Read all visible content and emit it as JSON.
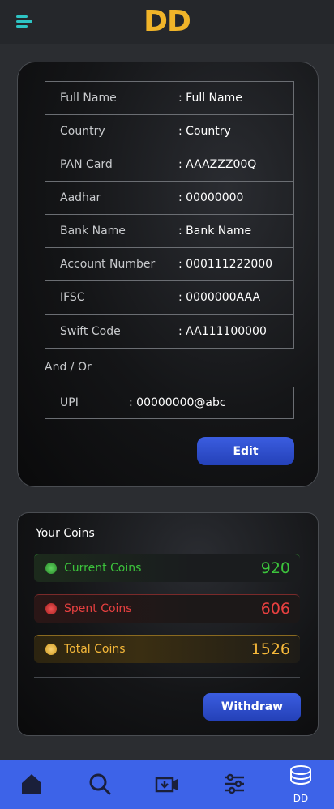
{
  "header": {
    "logo": "DD"
  },
  "profile": {
    "rows": [
      {
        "label": "Full Name",
        "value": ": Full Name"
      },
      {
        "label": "Country",
        "value": ": Country"
      },
      {
        "label": "PAN Card",
        "value": ": AAAZZZ00Q"
      },
      {
        "label": "Aadhar",
        "value": ": 00000000"
      },
      {
        "label": "Bank Name",
        "value": ": Bank Name"
      },
      {
        "label": "Account Number",
        "value": ": 000111222000"
      },
      {
        "label": "IFSC",
        "value": ": 0000000AAA"
      },
      {
        "label": "Swift Code",
        "value": ": AA111100000"
      }
    ],
    "and_or": "And / Or",
    "upi": {
      "label": "UPI",
      "value": ": 00000000@abc"
    },
    "edit_label": "Edit"
  },
  "coins": {
    "title": "Your Coins",
    "current": {
      "label": "Current Coins",
      "value": "920",
      "color": "#3cc43c"
    },
    "spent": {
      "label": "Spent Coins",
      "value": "606",
      "color": "#e84040"
    },
    "total": {
      "label": "Total Coins",
      "value": "1526",
      "color": "#f5b83a"
    },
    "withdraw_label": "Withdraw"
  },
  "nav": {
    "items": [
      "home-icon",
      "search-icon",
      "video-download-icon",
      "sliders-icon",
      "coins-icon"
    ],
    "dd_label": "DD",
    "background": "#3d63e8"
  }
}
